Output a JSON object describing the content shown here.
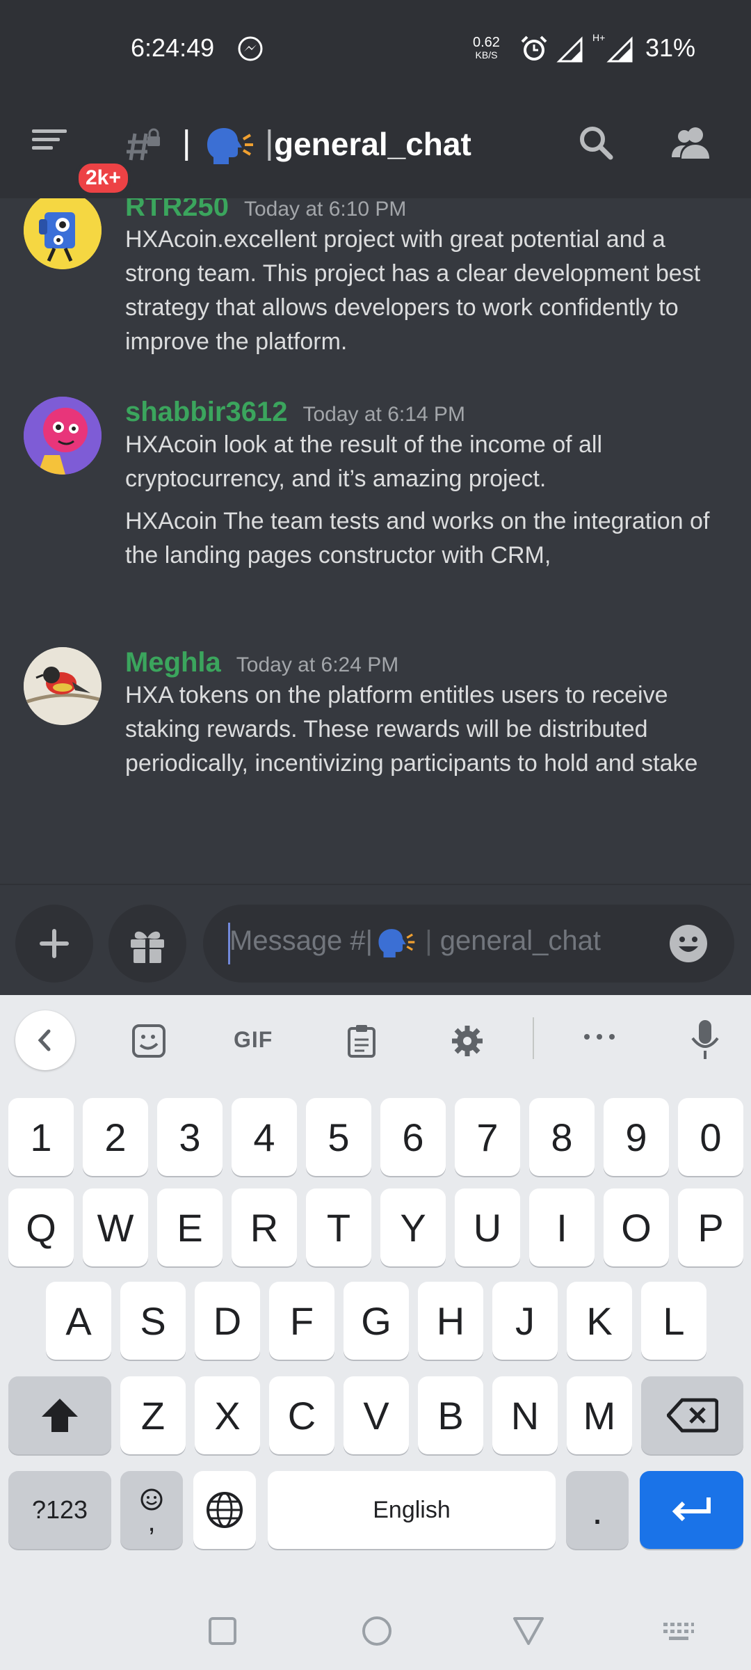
{
  "status_bar": {
    "time": "6:24:49",
    "net_speed": "0.62",
    "net_speed_unit": "KB/S",
    "network_type": "H+",
    "battery": "31%"
  },
  "header": {
    "unread_badge": "2k+",
    "channel_prefix": "|",
    "channel_name": "general_chat"
  },
  "messages": [
    {
      "author": "RTR250",
      "timestamp": "Today at 6:10 PM",
      "lines": [
        "HXAcoin.excellent project with great potential and a strong team. This project has a clear development best strategy that allows developers to work confidently to improve the platform."
      ]
    },
    {
      "author": "shabbir3612",
      "timestamp": "Today at 6:14 PM",
      "lines": [
        "HXAcoin look at the result of the income of all cryptocurrency, and it’s amazing project.",
        "HXAcoin The team tests and works on the integration of the landing pages constructor with CRM,"
      ]
    },
    {
      "author": "Meghla",
      "timestamp": "Today at 6:24 PM",
      "lines": [
        "HXA tokens on the platform entitles users to receive staking rewards. These rewards will be distributed periodically, incentivizing participants to hold and stake"
      ]
    }
  ],
  "composer": {
    "placeholder_prefix": "Message #",
    "placeholder_sep": "|",
    "placeholder_channel": "general_chat"
  },
  "keyboard": {
    "toolbar_gif": "GIF",
    "row_numbers": [
      "1",
      "2",
      "3",
      "4",
      "5",
      "6",
      "7",
      "8",
      "9",
      "0"
    ],
    "row_1": [
      "Q",
      "W",
      "E",
      "R",
      "T",
      "Y",
      "U",
      "I",
      "O",
      "P"
    ],
    "row_2": [
      "A",
      "S",
      "D",
      "F",
      "G",
      "H",
      "J",
      "K",
      "L"
    ],
    "row_3": [
      "Z",
      "X",
      "C",
      "V",
      "B",
      "N",
      "M"
    ],
    "symbols_key": "?123",
    "comma_key": ",",
    "space_label": "English",
    "period_key": "."
  },
  "colors": {
    "author": "#3ba55d",
    "badge": "#ed4245",
    "enter_key": "#1a73e8",
    "chat_bg": "#36393f",
    "header_bg": "#2f3136"
  }
}
